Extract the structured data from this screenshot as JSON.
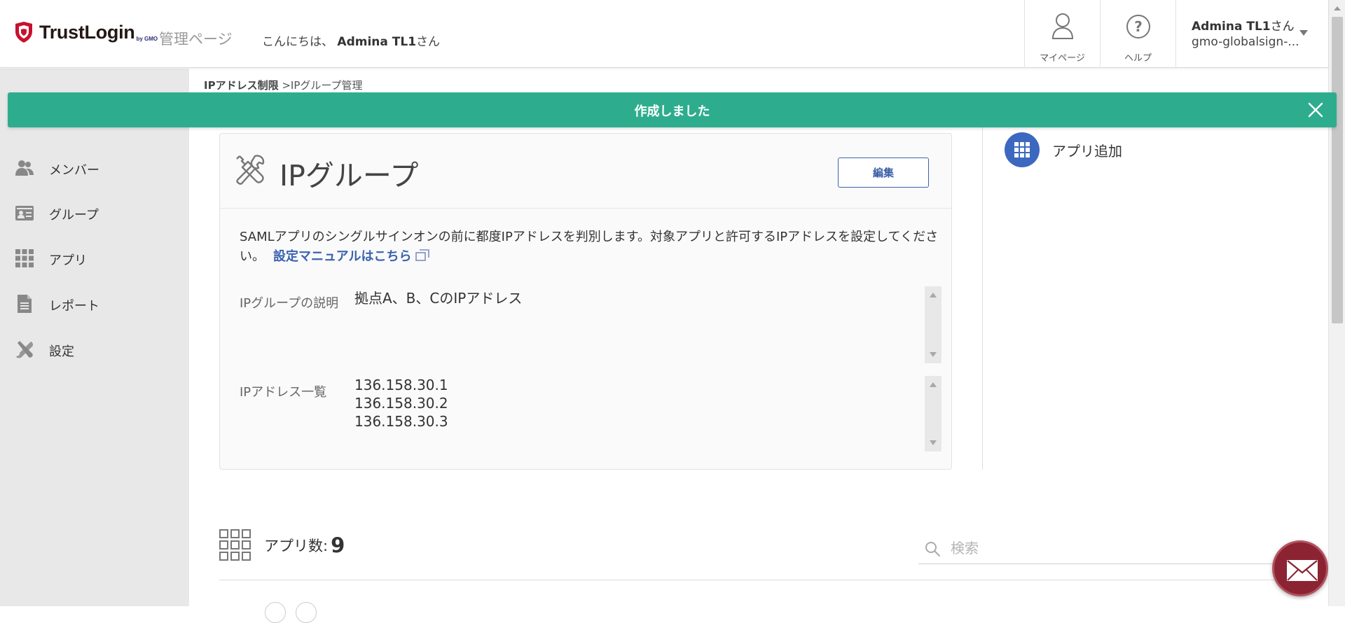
{
  "header": {
    "logo_text": "TrustLogin",
    "logo_by": "by GMO",
    "admin_page_label": "管理ページ",
    "greeting_prefix": "こんにちは、",
    "greeting_name": "Admina TL1",
    "greeting_suffix": "さん",
    "mypage_label": "マイページ",
    "help_label": "ヘルプ",
    "user_name": "Admina TL1",
    "user_name_suffix": "さん",
    "user_org": "gmo-globalsign-..."
  },
  "sidebar": {
    "items": [
      {
        "label": "メンバー",
        "icon": "members-icon"
      },
      {
        "label": "グループ",
        "icon": "group-icon"
      },
      {
        "label": "アプリ",
        "icon": "apps-icon"
      },
      {
        "label": "レポート",
        "icon": "report-icon"
      },
      {
        "label": "設定",
        "icon": "settings-icon"
      }
    ]
  },
  "breadcrumb": {
    "parent": "IPアドレス制限",
    "separator": " >",
    "current": "IPグループ管理"
  },
  "toast": {
    "message": "作成しました"
  },
  "ip_group": {
    "title": "IPグループ",
    "edit_label": "編集",
    "description": "SAMLアプリのシングルサインオンの前に都度IPアドレスを判別します。対象アプリと許可するIPアドレスを設定してください。",
    "manual_link": "設定マニュアルはこちら",
    "description_label": "IPグループの説明",
    "description_value": "拠点A、B、CのIPアドレス",
    "ip_list_label": "IPアドレス一覧",
    "ip_addresses": [
      "136.158.30.1",
      "136.158.30.2",
      "136.158.30.3"
    ]
  },
  "add_app": {
    "label": "アプリ追加"
  },
  "apps": {
    "count_label": "アプリ数:",
    "count": "9",
    "search_placeholder": "検索"
  },
  "colors": {
    "toast_bg": "#2ead8e",
    "accent_blue": "#3d68c0",
    "mail_fab": "#8b2332",
    "logo_red": "#c8102e"
  }
}
